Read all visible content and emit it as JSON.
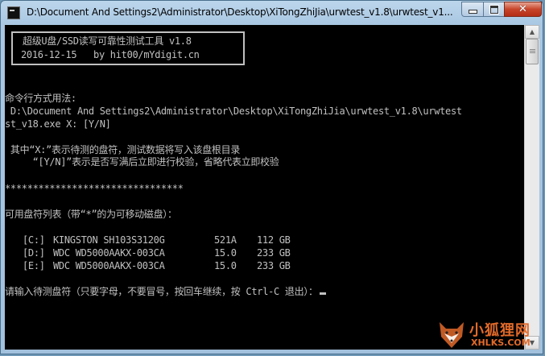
{
  "window": {
    "title": "D:\\Document And Settings2\\Administrator\\Desktop\\XiTongZhiJia\\urwtest_v1.8\\urwtest_v1...",
    "icon": "cmd-icon",
    "controls": {
      "minimize": "minimize-icon",
      "maximize": "maximize-icon",
      "close": "✕"
    }
  },
  "console": {
    "banner": {
      "line1": "超级U盘/SSD读写可靠性测试工具 v1.8",
      "line2": "2016-12-15   by hit00/mYdigit.cn"
    },
    "usage_header": "命令行方式用法:",
    "usage_cmd_1": " D:\\Document And Settings2\\Administrator\\Desktop\\XiTongZhiJia\\urwtest_v1.8\\urwtest",
    "usage_cmd_2": "st_v18.exe X: [Y/N]",
    "desc_1": " 其中“X:”表示待测的盘符，测试数据将写入该盘根目录",
    "desc_2": "     “[Y/N]”表示是否写满后立即进行校验，省略代表立即校验",
    "separator": "********************************",
    "drives_header": "可用盘符列表（带“*”的为可移动磁盘）：",
    "drives": [
      {
        "letter": "[C:]",
        "model": "KINGSTON SH103S3120G",
        "fw": "521A",
        "size": "112 GB"
      },
      {
        "letter": "[D:]",
        "model": "WDC WD5000AAKX-003CA",
        "fw": "15.0",
        "size": "233 GB"
      },
      {
        "letter": "[E:]",
        "model": "WDC WD5000AAKX-003CA",
        "fw": "15.0",
        "size": "233 GB"
      }
    ],
    "prompt": "请输入待测盘符（只要字母，不要冒号，按回车继续，按 Ctrl-C 退出）："
  },
  "watermark": {
    "name": "小狐狸网",
    "url": "XHLKS.COM"
  },
  "colors": {
    "console_bg": "#000000",
    "console_fg": "#c0c0c0",
    "watermark": "#e26a2a"
  }
}
